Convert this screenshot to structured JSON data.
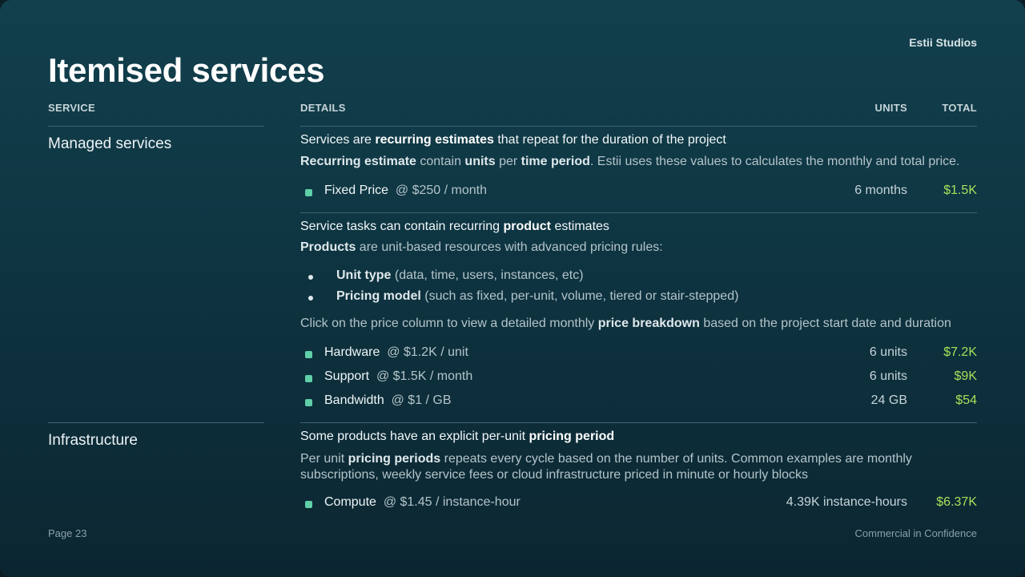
{
  "brand": "Estii Studios",
  "title": "Itemised services",
  "headers": {
    "service": "SERVICE",
    "details": "DETAILS",
    "units": "UNITS",
    "total": "TOTAL"
  },
  "sections": {
    "managed": {
      "name": "Managed services",
      "intro_pre": "Services are ",
      "intro_b": "recurring estimates",
      "intro_post": " that repeat for the duration of the project",
      "desc_b1": "Recurring estimate",
      "desc_t1": " contain ",
      "desc_b2": "units",
      "desc_t2": " per ",
      "desc_b3": "time period",
      "desc_t3": ". Estii uses these values to calculates the monthly and total price.",
      "fixed": {
        "name": "Fixed Price",
        "rate": "@ $250 / month",
        "units": "6 months",
        "total": "$1.5K"
      },
      "product_pre": "Service tasks can contain recurring ",
      "product_b": "product",
      "product_post": " estimates",
      "products_b": "Products",
      "products_post": " are unit-based resources with advanced pricing rules:",
      "bullet1_b": "Unit type",
      "bullet1_t": " (data, time, users, instances, etc)",
      "bullet2_b": "Pricing model",
      "bullet2_t": " (such as fixed, per-unit, volume, tiered or stair-stepped)",
      "click_pre": "Click on the price column to view a detailed monthly ",
      "click_b": "price breakdown",
      "click_post": " based on the project start date and duration",
      "items": [
        {
          "name": "Hardware",
          "rate": "@ $1.2K / unit",
          "units": "6 units",
          "total": "$7.2K"
        },
        {
          "name": "Support",
          "rate": "@ $1.5K / month",
          "units": "6 units",
          "total": "$9K"
        },
        {
          "name": "Bandwidth",
          "rate": "@ $1 / GB",
          "units": "24 GB",
          "total": "$54"
        }
      ]
    },
    "infra": {
      "name": "Infrastructure",
      "intro_pre": "Some products have an explicit per-unit ",
      "intro_b": "pricing period",
      "para_pre": "Per unit ",
      "para_b": "pricing periods",
      "para_post": " repeats every cycle based on the number of units. Common examples are monthly subscriptions, weekly service fees or cloud infrastructure priced in minute or hourly blocks",
      "items": [
        {
          "name": "Compute",
          "rate": "@ $1.45 / instance-hour",
          "units": "4.39K instance-hours",
          "total": "$6.37K"
        }
      ]
    }
  },
  "footer": {
    "page": "Page 23",
    "confidential": "Commercial in Confidence"
  },
  "colors": {
    "accent_square": "#5fd0a8",
    "total_green": "#a6e05a",
    "background_top": "#12404d",
    "background_bottom": "#0b2631"
  }
}
